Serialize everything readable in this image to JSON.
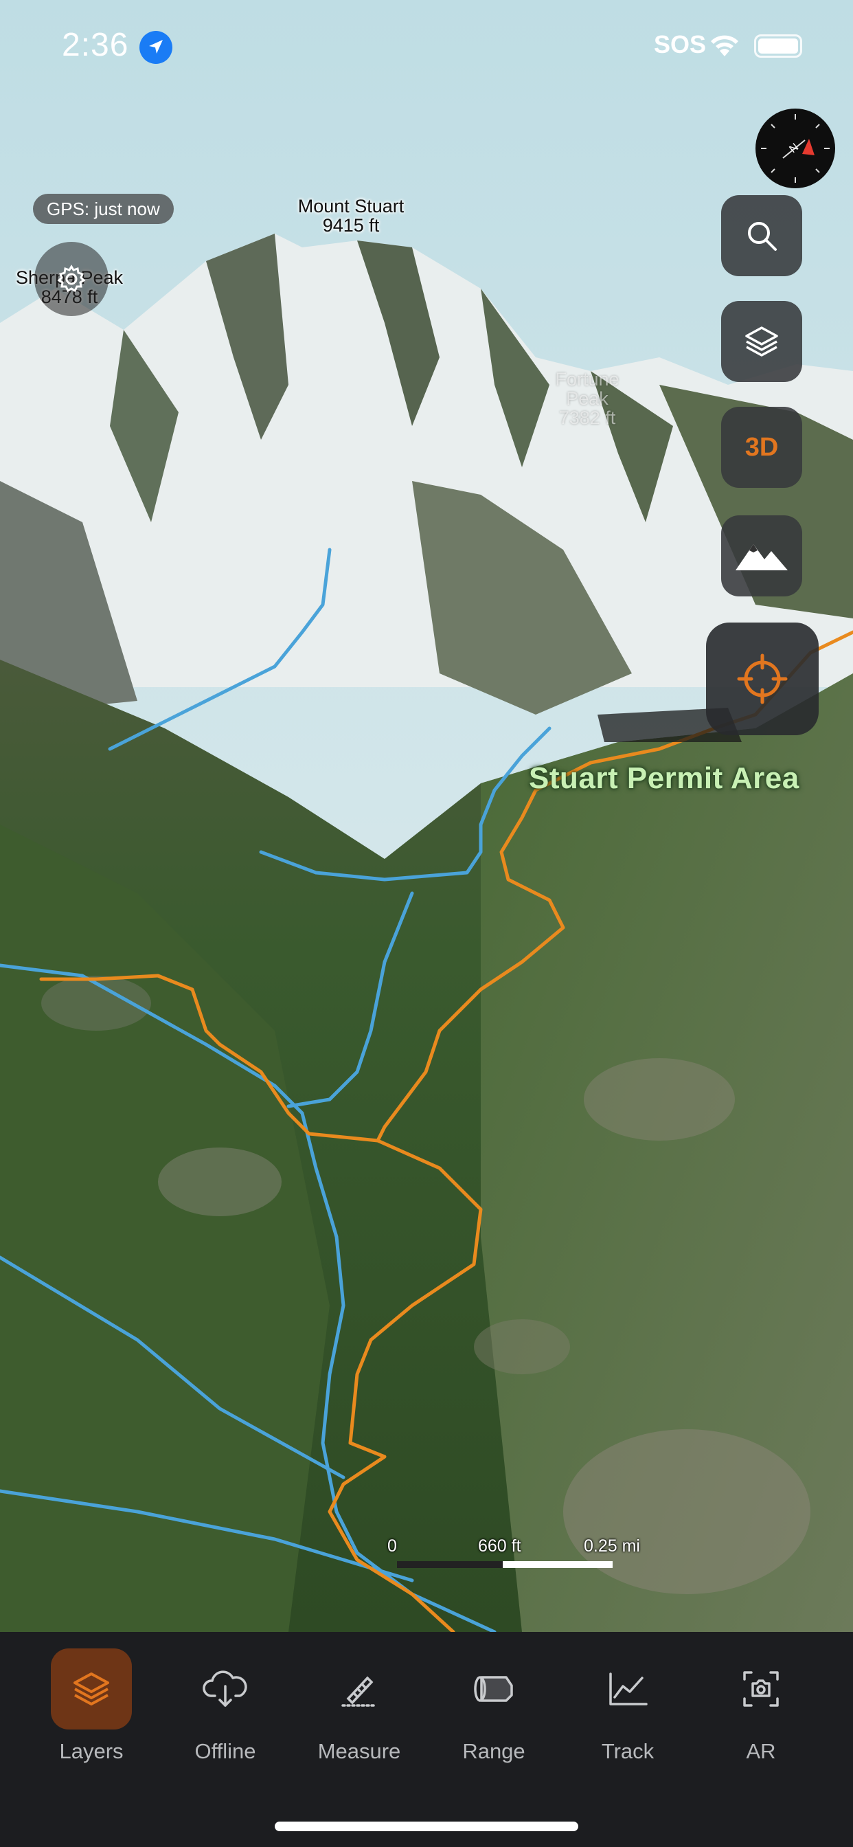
{
  "status_bar": {
    "time": "2:36",
    "sos": "SOS"
  },
  "map": {
    "gps_status": "GPS: just now",
    "peaks": [
      {
        "name": "Mount Stuart",
        "elevation": "9415 ft"
      },
      {
        "name": "Sherpa Peak",
        "elevation": "8478 ft"
      },
      {
        "name": "Fortune Peak",
        "elevation": "7382 ft"
      }
    ],
    "area_label": "Stuart Permit Area",
    "scale": {
      "zero": "0",
      "mid": "660 ft",
      "end": "0.25 mi"
    },
    "controls": {
      "three_d": "3D"
    }
  },
  "tabs": [
    {
      "label": "Layers",
      "icon": "layers-icon",
      "active": true
    },
    {
      "label": "Offline",
      "icon": "cloud-download-icon"
    },
    {
      "label": "Measure",
      "icon": "ruler-icon"
    },
    {
      "label": "Range",
      "icon": "rangefinder-icon"
    },
    {
      "label": "Track",
      "icon": "track-chart-icon"
    },
    {
      "label": "AR",
      "icon": "camera-ar-icon"
    }
  ],
  "colors": {
    "accent": "#e2761f",
    "trail": "#e98a1e",
    "stream": "#4aa3d9",
    "tab_bar": "#1c1d20"
  }
}
